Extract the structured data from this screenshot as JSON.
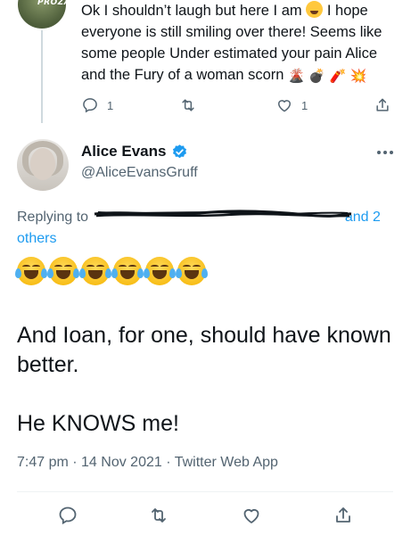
{
  "reply_tweet": {
    "avatar_logo_text": "PROZAC",
    "text_before_emoji": "Ok I shouldn’t laugh but here I am",
    "text_after_emoji": " I hope everyone is still smiling over there! Seems like some people Under estimated your pain Alice and the Fury of a woman scorn",
    "trailing_emojis": [
      "volcano",
      "bomb",
      "firecracker",
      "collision"
    ],
    "actions": {
      "reply_count": "1",
      "retweet_count": "",
      "like_count": "1"
    }
  },
  "tweet": {
    "author_name": "Alice Evans",
    "author_handle": "@AliceEvansGruff",
    "verified": true,
    "replying_prefix": "Replying to",
    "replying_others": "and 2 others",
    "emoji_row": [
      "face-with-tears-of-joy",
      "face-with-tears-of-joy",
      "face-with-tears-of-joy",
      "face-with-tears-of-joy",
      "face-with-tears-of-joy",
      "face-with-tears-of-joy"
    ],
    "line1": "And Ioan, for one, should have known better.",
    "line2": "He KNOWS me!",
    "time": "7:47 pm",
    "date": "14 Nov 2021",
    "source": "Twitter Web App",
    "separator": " · "
  },
  "colors": {
    "accent": "#1d9bf0",
    "muted": "#536471",
    "text": "#0f1419",
    "divider": "#eff3f4"
  }
}
